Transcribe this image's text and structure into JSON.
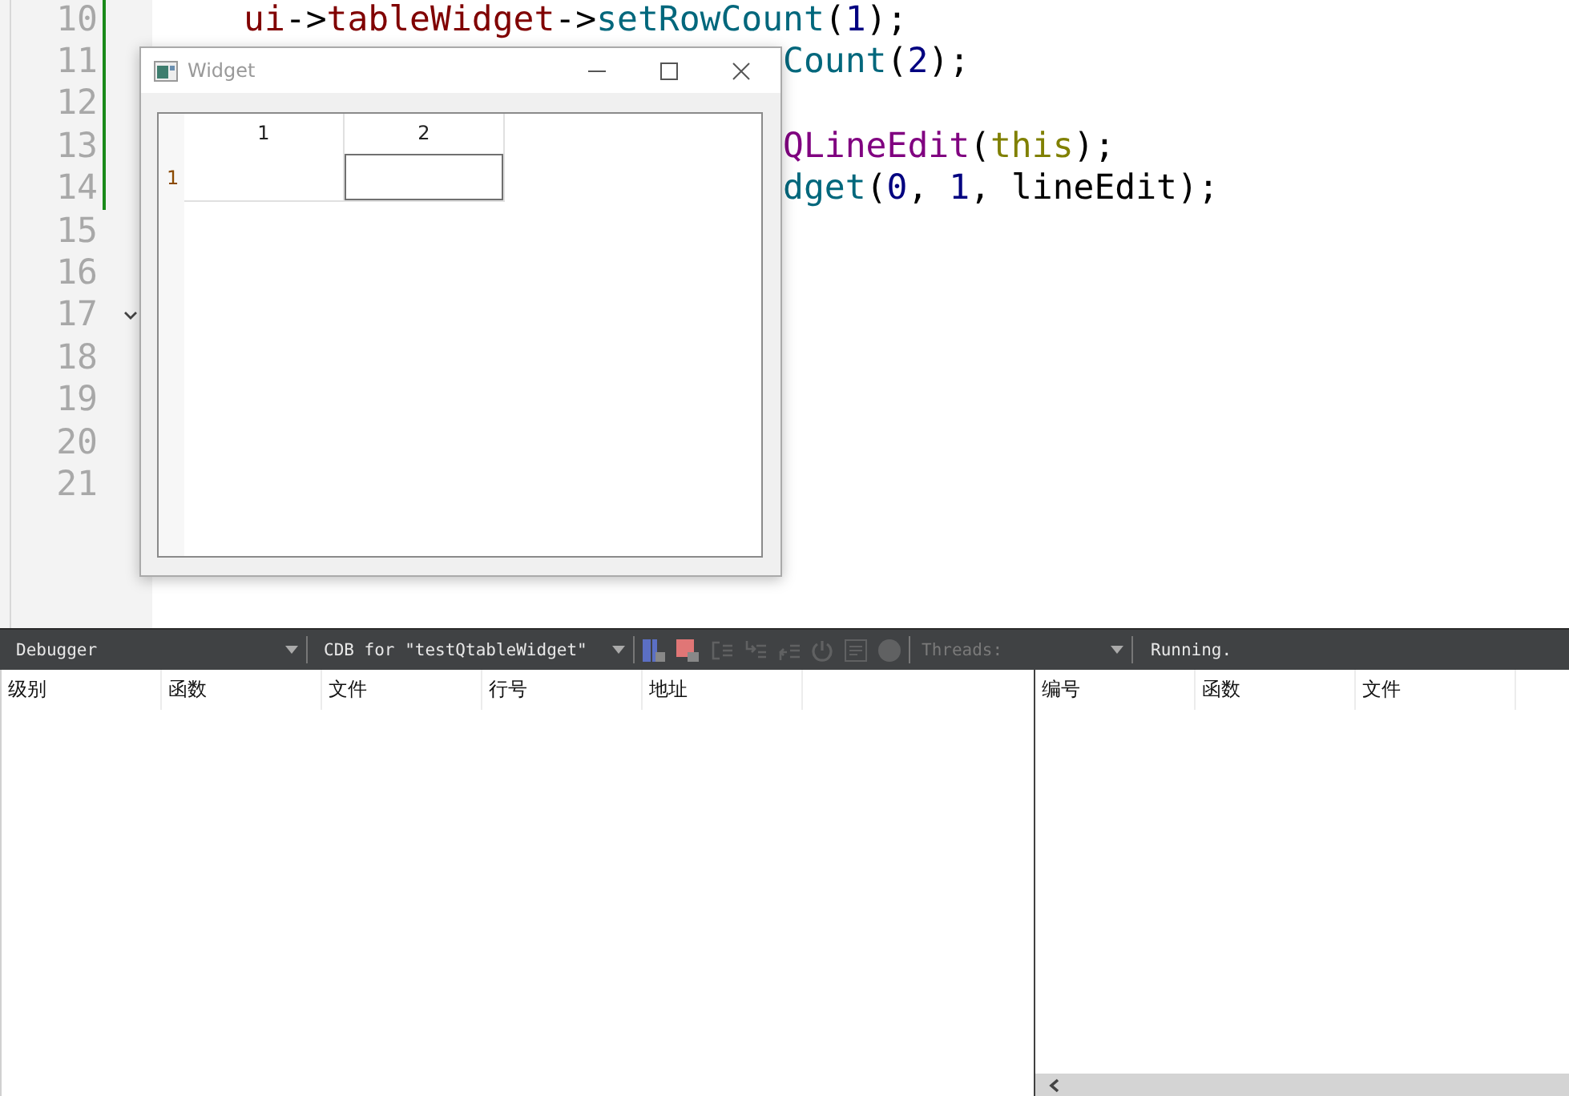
{
  "editor": {
    "lines": [
      {
        "number": "10",
        "behind_window": false,
        "tokens": [
          {
            "kind": "member",
            "text": "ui"
          },
          {
            "kind": "plain",
            "text": "->"
          },
          {
            "kind": "member",
            "text": "tableWidget"
          },
          {
            "kind": "plain",
            "text": "->"
          },
          {
            "kind": "function",
            "text": "setRowCount"
          },
          {
            "kind": "plain",
            "text": "("
          },
          {
            "kind": "number",
            "text": "1"
          },
          {
            "kind": "plain",
            "text": ");"
          }
        ]
      },
      {
        "number": "11",
        "behind_window": true,
        "tokens": [
          {
            "kind": "function",
            "text": "Count"
          },
          {
            "kind": "plain",
            "text": "("
          },
          {
            "kind": "number",
            "text": "2"
          },
          {
            "kind": "plain",
            "text": ");"
          }
        ]
      },
      {
        "number": "12"
      },
      {
        "number": "13",
        "behind_window": true,
        "tokens": [
          {
            "kind": "type",
            "text": "QLineEdit"
          },
          {
            "kind": "plain",
            "text": "("
          },
          {
            "kind": "keyword",
            "text": "this"
          },
          {
            "kind": "plain",
            "text": ");"
          }
        ]
      },
      {
        "number": "14",
        "behind_window": true,
        "tokens": [
          {
            "kind": "function",
            "text": "dget"
          },
          {
            "kind": "plain",
            "text": "("
          },
          {
            "kind": "number",
            "text": "0"
          },
          {
            "kind": "plain",
            "text": ", "
          },
          {
            "kind": "number",
            "text": "1"
          },
          {
            "kind": "plain",
            "text": ", "
          },
          {
            "kind": "plain",
            "text": "lineEdit"
          },
          {
            "kind": "plain",
            "text": ");"
          }
        ]
      },
      {
        "number": "15"
      },
      {
        "number": "16"
      },
      {
        "number": "17",
        "foldable": true
      },
      {
        "number": "18"
      },
      {
        "number": "19"
      },
      {
        "number": "20"
      },
      {
        "number": "21"
      }
    ]
  },
  "widget_window": {
    "title": "Widget",
    "table": {
      "columns": [
        "1",
        "2"
      ],
      "rows": [
        {
          "header": "1",
          "cells": [
            {
              "kind": "empty"
            },
            {
              "kind": "line_edit"
            }
          ]
        }
      ]
    }
  },
  "debugger_toolbar": {
    "perspective": "Debugger",
    "engine": "CDB for \"testQtableWidget\"",
    "buttons": [
      {
        "kind": "continue",
        "enabled": true
      },
      {
        "kind": "stop",
        "enabled": true
      },
      {
        "kind": "step-over",
        "enabled": false
      },
      {
        "kind": "step-into",
        "enabled": false
      },
      {
        "kind": "step-out",
        "enabled": false
      },
      {
        "kind": "restart",
        "enabled": false
      },
      {
        "kind": "operate",
        "enabled": false
      },
      {
        "kind": "record",
        "enabled": false
      }
    ],
    "threads": {
      "label": "Threads:",
      "disabled": true
    },
    "status": "Running."
  },
  "stack_pane": {
    "columns": [
      "级别",
      "函数",
      "文件",
      "行号",
      "地址"
    ]
  },
  "breakpoints_pane": {
    "columns": [
      "编号",
      "函数",
      "文件"
    ]
  }
}
